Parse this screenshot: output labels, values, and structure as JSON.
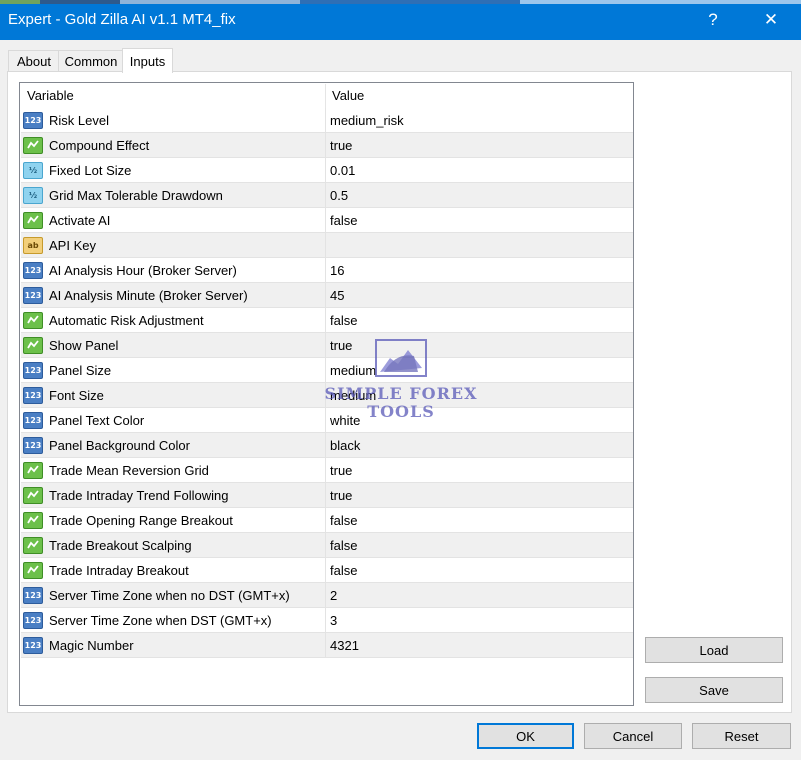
{
  "window": {
    "title": "Expert - Gold Zilla AI v1.1 MT4_fix",
    "help_glyph": "?",
    "close_glyph": "✕"
  },
  "tabs": [
    {
      "label": "About",
      "active": false
    },
    {
      "label": "Common",
      "active": false
    },
    {
      "label": "Inputs",
      "active": true
    }
  ],
  "table": {
    "columns": [
      "Variable",
      "Value"
    ],
    "rows": [
      {
        "icon": "integer-icon",
        "icon_text": "123",
        "variable": "Risk Level",
        "value": "medium_risk"
      },
      {
        "icon": "boolean-icon",
        "icon_text": "",
        "variable": "Compound Effect",
        "value": "true"
      },
      {
        "icon": "double-icon",
        "icon_text": "½",
        "variable": "Fixed Lot Size",
        "value": "0.01"
      },
      {
        "icon": "double-icon",
        "icon_text": "½",
        "variable": "Grid Max Tolerable Drawdown",
        "value": "0.5"
      },
      {
        "icon": "boolean-icon",
        "icon_text": "",
        "variable": "Activate AI",
        "value": "false"
      },
      {
        "icon": "string-icon",
        "icon_text": "ab",
        "variable": "API Key",
        "value": ""
      },
      {
        "icon": "integer-icon",
        "icon_text": "123",
        "variable": "AI Analysis Hour (Broker Server)",
        "value": "16"
      },
      {
        "icon": "integer-icon",
        "icon_text": "123",
        "variable": "AI Analysis Minute (Broker Server)",
        "value": "45"
      },
      {
        "icon": "boolean-icon",
        "icon_text": "",
        "variable": "Automatic Risk Adjustment",
        "value": "false"
      },
      {
        "icon": "boolean-icon",
        "icon_text": "",
        "variable": "Show Panel",
        "value": "true"
      },
      {
        "icon": "integer-icon",
        "icon_text": "123",
        "variable": "Panel Size",
        "value": "medium"
      },
      {
        "icon": "integer-icon",
        "icon_text": "123",
        "variable": "Font Size",
        "value": "medium"
      },
      {
        "icon": "integer-icon",
        "icon_text": "123",
        "variable": "Panel Text Color",
        "value": "white"
      },
      {
        "icon": "integer-icon",
        "icon_text": "123",
        "variable": "Panel Background Color",
        "value": "black"
      },
      {
        "icon": "boolean-icon",
        "icon_text": "",
        "variable": "Trade Mean Reversion Grid",
        "value": "true"
      },
      {
        "icon": "boolean-icon",
        "icon_text": "",
        "variable": "Trade Intraday Trend Following",
        "value": "true"
      },
      {
        "icon": "boolean-icon",
        "icon_text": "",
        "variable": "Trade Opening Range Breakout",
        "value": "false"
      },
      {
        "icon": "boolean-icon",
        "icon_text": "",
        "variable": "Trade Breakout Scalping",
        "value": "false"
      },
      {
        "icon": "boolean-icon",
        "icon_text": "",
        "variable": "Trade Intraday Breakout",
        "value": "false"
      },
      {
        "icon": "integer-icon",
        "icon_text": "123",
        "variable": "Server Time Zone when no DST (GMT+x)",
        "value": "2"
      },
      {
        "icon": "integer-icon",
        "icon_text": "123",
        "variable": "Server Time Zone when DST (GMT+x)",
        "value": "3"
      },
      {
        "icon": "integer-icon",
        "icon_text": "123",
        "variable": "Magic Number",
        "value": "4321"
      }
    ]
  },
  "side_buttons": {
    "load": "Load",
    "save": "Save"
  },
  "footer_buttons": {
    "ok": "OK",
    "cancel": "Cancel",
    "reset": "Reset"
  },
  "watermark": {
    "line1": "SIMPLE FOREX",
    "line2": "TOOLS"
  },
  "colors": {
    "titlebar": "#0078d7",
    "default_button_border": "#0078d7"
  }
}
